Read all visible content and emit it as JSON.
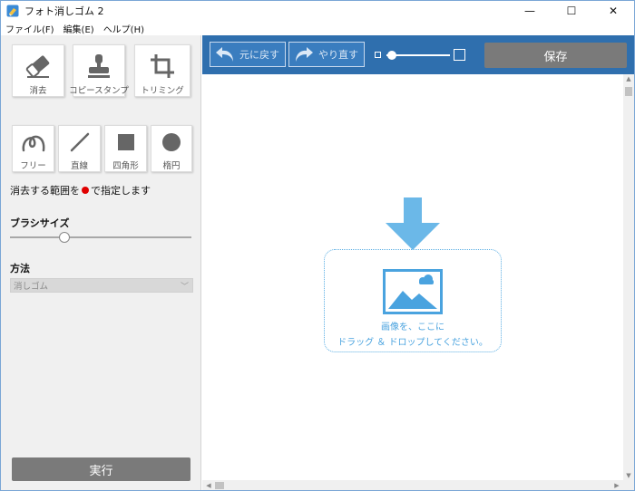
{
  "window": {
    "title": "フォト消しゴム 2",
    "controls": {
      "minimize": "—",
      "maximize": "☐",
      "close": "✕"
    }
  },
  "menu": [
    "ファイル(F)",
    "編集(E)",
    "ヘルプ(H)"
  ],
  "tools": [
    {
      "label": "消去",
      "icon": "eraser-icon"
    },
    {
      "label": "コピースタンプ",
      "icon": "stamp-icon"
    },
    {
      "label": "トリミング",
      "icon": "crop-icon"
    }
  ],
  "shapes": [
    {
      "label": "フリー",
      "icon": "freehand-icon"
    },
    {
      "label": "直線",
      "icon": "line-icon"
    },
    {
      "label": "四角形",
      "icon": "square-icon"
    },
    {
      "label": "楕円",
      "icon": "circle-icon"
    }
  ],
  "hint": {
    "before": "消去する範囲を",
    "after": "で指定します",
    "dot_color": "#e00000"
  },
  "brush_size": {
    "label": "ブラシサイズ",
    "value_fraction": 0.3
  },
  "method": {
    "label": "方法",
    "selected": "消しゴム"
  },
  "run_button": "実行",
  "toolbar": {
    "undo": "元に戻す",
    "redo": "やり直す",
    "save": "保存",
    "zoom_fraction": 0.05
  },
  "drop_zone": {
    "line1": "画像を、ここに",
    "line2": "ドラッグ ＆ ドロップしてください。"
  },
  "colors": {
    "toolbar_blue": "#2f6fae",
    "accent_blue": "#4aa3df",
    "button_gray": "#7a7a7a"
  }
}
